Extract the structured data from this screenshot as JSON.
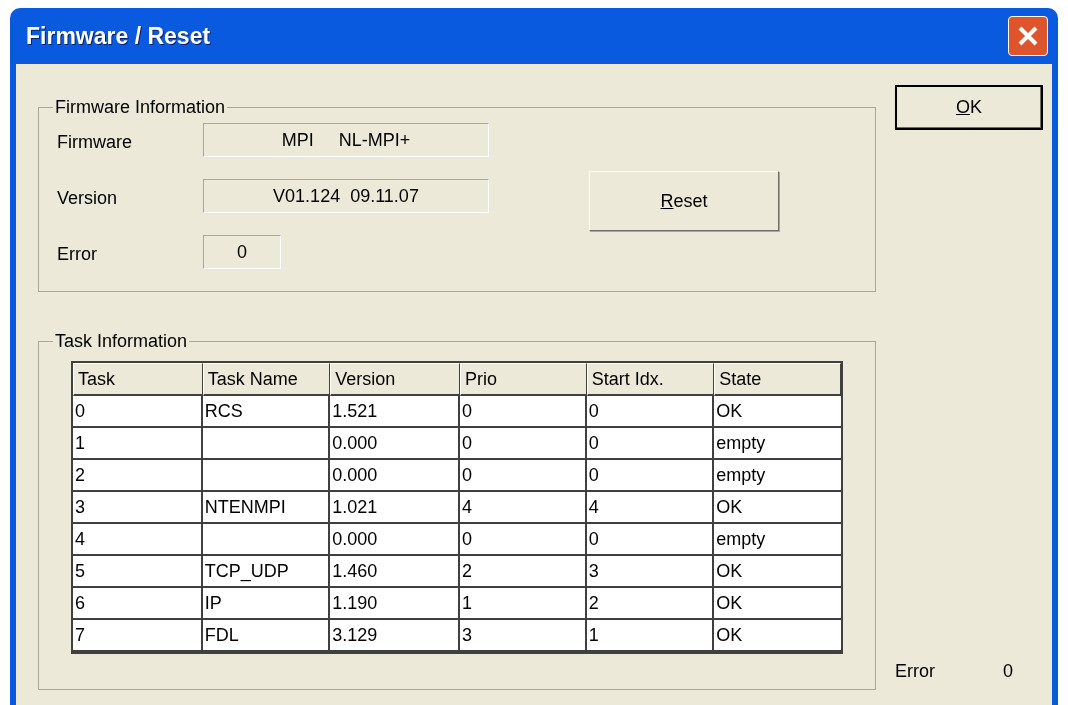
{
  "window": {
    "title": "Firmware / Reset"
  },
  "firmware_information": {
    "title": "Firmware Information",
    "fields": [
      {
        "label": "Firmware",
        "value": "MPI     NL-MPI+",
        "kind": "wide"
      },
      {
        "label": "Version",
        "value": "V01.124  09.11.07",
        "kind": "wide"
      },
      {
        "label": "Error",
        "value": "0",
        "kind": "narrow"
      }
    ],
    "reset_button": {
      "label": "Reset",
      "underline_first": true
    }
  },
  "task_information": {
    "title": "Task Information",
    "table": {
      "columns": [
        "Task",
        "Task Name",
        "Version",
        "Prio",
        "Start Idx.",
        "State"
      ],
      "rows": [
        [
          "0",
          "RCS",
          "1.521",
          "0",
          "0",
          "OK"
        ],
        [
          "1",
          "",
          "0.000",
          "0",
          "0",
          "empty"
        ],
        [
          "2",
          "",
          "0.000",
          "0",
          "0",
          "empty"
        ],
        [
          "3",
          "NTENMPI",
          "1.021",
          "4",
          "4",
          "OK"
        ],
        [
          "4",
          "",
          "0.000",
          "0",
          "0",
          "empty"
        ],
        [
          "5",
          "TCP_UDP",
          "1.460",
          "2",
          "3",
          "OK"
        ],
        [
          "6",
          "IP",
          "1.190",
          "1",
          "2",
          "OK"
        ],
        [
          "7",
          "FDL",
          "3.129",
          "3",
          "1",
          "OK"
        ]
      ]
    }
  },
  "ok_button": {
    "label": "OK",
    "underline_first": true
  },
  "status": {
    "label": "Error",
    "value": "0"
  }
}
